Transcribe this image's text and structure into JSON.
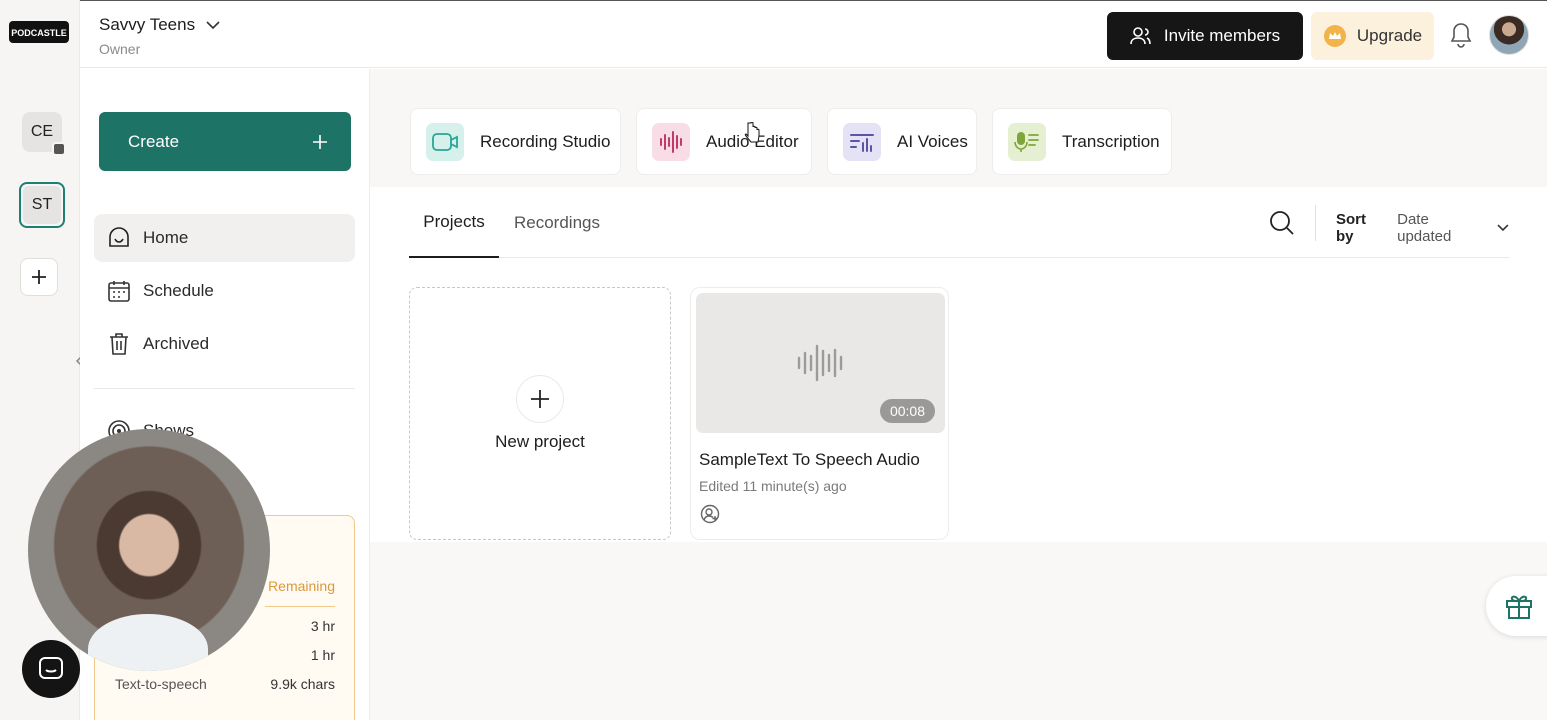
{
  "brand": {
    "logo_text": "PODCASTLE"
  },
  "rail": {
    "workspaces": [
      {
        "initials": "CE"
      },
      {
        "initials": "ST"
      }
    ]
  },
  "header": {
    "team_name": "Savvy Teens",
    "team_role": "Owner",
    "invite_label": "Invite members",
    "upgrade_label": "Upgrade"
  },
  "sidebar": {
    "create_label": "Create",
    "nav": [
      {
        "label": "Home",
        "active": true
      },
      {
        "label": "Schedule"
      },
      {
        "label": "Archived"
      },
      {
        "label": "Shows"
      }
    ],
    "usage": {
      "remaining_label": "Remaining",
      "rows": [
        {
          "label": "",
          "value": "3 hr"
        },
        {
          "label": "",
          "value": "1 hr"
        },
        {
          "label": "Text-to-speech",
          "value": "9.9k chars"
        }
      ]
    }
  },
  "tools": [
    {
      "label": "Recording Studio"
    },
    {
      "label": "Audio Editor"
    },
    {
      "label": "AI Voices"
    },
    {
      "label": "Transcription"
    }
  ],
  "tabs": [
    {
      "label": "Projects",
      "active": true
    },
    {
      "label": "Recordings"
    }
  ],
  "sort": {
    "label": "Sort by",
    "value": "Date updated"
  },
  "new_project": {
    "label": "New project"
  },
  "projects": [
    {
      "title": "SampleText To Speech Audio",
      "edited": "Edited 11 minute(s) ago",
      "duration": "00:08"
    }
  ],
  "colors": {
    "accent": "#1e7367",
    "upgrade_bg": "#fbf1dc",
    "invite_bg": "#161616"
  }
}
